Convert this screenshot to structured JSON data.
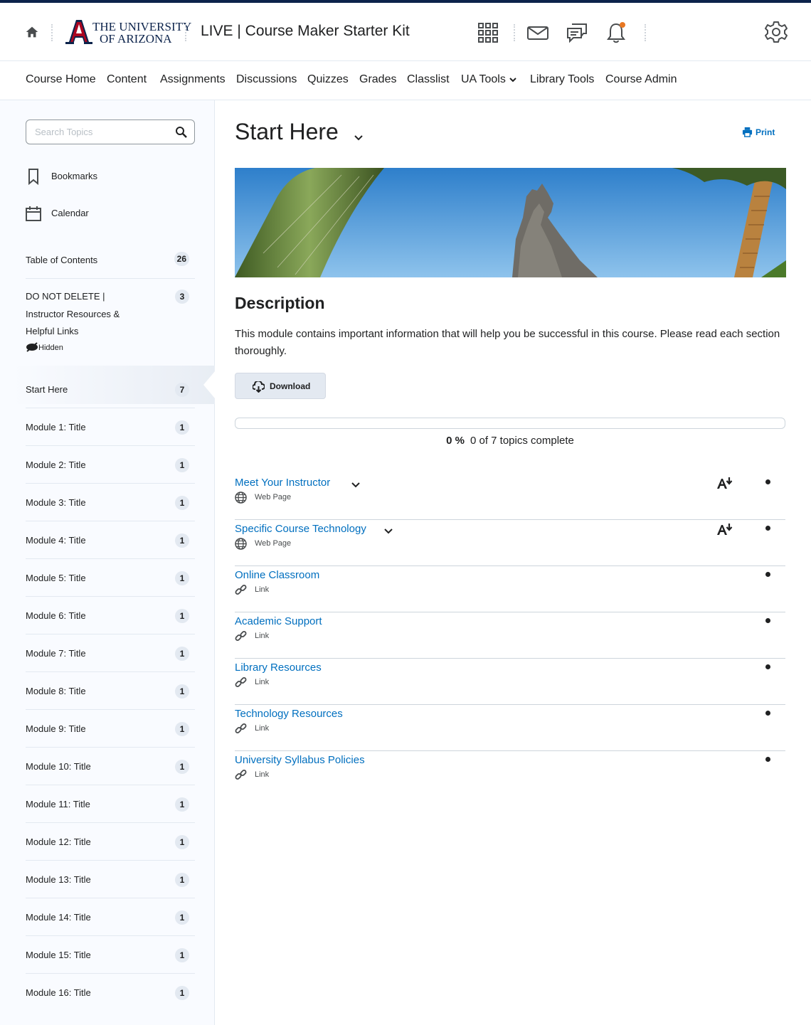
{
  "header": {
    "university_line1": "THE UNIVERSITY",
    "university_line2": "OF ARIZONA",
    "course_title": "LIVE | Course Maker Starter Kit"
  },
  "nav": {
    "items": [
      "Course Home",
      "Content",
      "Assignments",
      "Discussions",
      "Quizzes",
      "Grades",
      "Classlist",
      "UA Tools",
      "Library Tools",
      "Course Admin"
    ]
  },
  "sidebar": {
    "search_placeholder": "Search Topics",
    "bookmarks": "Bookmarks",
    "calendar": "Calendar",
    "toc": {
      "label": "Table of Contents",
      "count": "26"
    },
    "hidden_module": {
      "line1": "DO NOT DELETE |",
      "line2": "Instructor Resources &",
      "line3": "Helpful Links",
      "count": "3",
      "hidden_label": "Hidden"
    },
    "modules": [
      {
        "label": "Start Here",
        "count": "7"
      },
      {
        "label": "Module 1: Title",
        "count": "1"
      },
      {
        "label": "Module 2: Title",
        "count": "1"
      },
      {
        "label": "Module 3: Title",
        "count": "1"
      },
      {
        "label": "Module 4: Title",
        "count": "1"
      },
      {
        "label": "Module 5: Title",
        "count": "1"
      },
      {
        "label": "Module 6: Title",
        "count": "1"
      },
      {
        "label": "Module 7: Title",
        "count": "1"
      },
      {
        "label": "Module 8: Title",
        "count": "1"
      },
      {
        "label": "Module 9: Title",
        "count": "1"
      },
      {
        "label": "Module 10: Title",
        "count": "1"
      },
      {
        "label": "Module 11: Title",
        "count": "1"
      },
      {
        "label": "Module 12: Title",
        "count": "1"
      },
      {
        "label": "Module 13: Title",
        "count": "1"
      },
      {
        "label": "Module 14: Title",
        "count": "1"
      },
      {
        "label": "Module 15: Title",
        "count": "1"
      },
      {
        "label": "Module 16: Title",
        "count": "1"
      }
    ]
  },
  "main": {
    "title": "Start Here",
    "print_label": "Print",
    "description_heading": "Description",
    "description_text": "This module contains important information that will help you be successful in this course. Please read each section thoroughly.",
    "download_label": "Download",
    "progress_percent": "0 %",
    "progress_fraction": 0,
    "progress_text": "0 of 7 topics complete",
    "topics": [
      {
        "title": "Meet Your Instructor",
        "type": "Web Page",
        "kind": "web",
        "dropdown": true,
        "readspeaker": true
      },
      {
        "title": "Specific Course Technology",
        "type": "Web Page",
        "kind": "web",
        "dropdown": true,
        "readspeaker": true
      },
      {
        "title": "Online Classroom",
        "type": "Link",
        "kind": "link",
        "dropdown": false,
        "readspeaker": false
      },
      {
        "title": "Academic Support",
        "type": "Link",
        "kind": "link",
        "dropdown": false,
        "readspeaker": false
      },
      {
        "title": "Library Resources",
        "type": "Link",
        "kind": "link",
        "dropdown": false,
        "readspeaker": false
      },
      {
        "title": "Technology Resources",
        "type": "Link",
        "kind": "link",
        "dropdown": false,
        "readspeaker": false
      },
      {
        "title": "University Syllabus Policies",
        "type": "Link",
        "kind": "link",
        "dropdown": false,
        "readspeaker": false
      }
    ]
  },
  "colors": {
    "brand_navy": "#0c234b",
    "brand_red": "#ab0520",
    "link_blue": "#006fbf",
    "notification_orange": "#e87722"
  }
}
